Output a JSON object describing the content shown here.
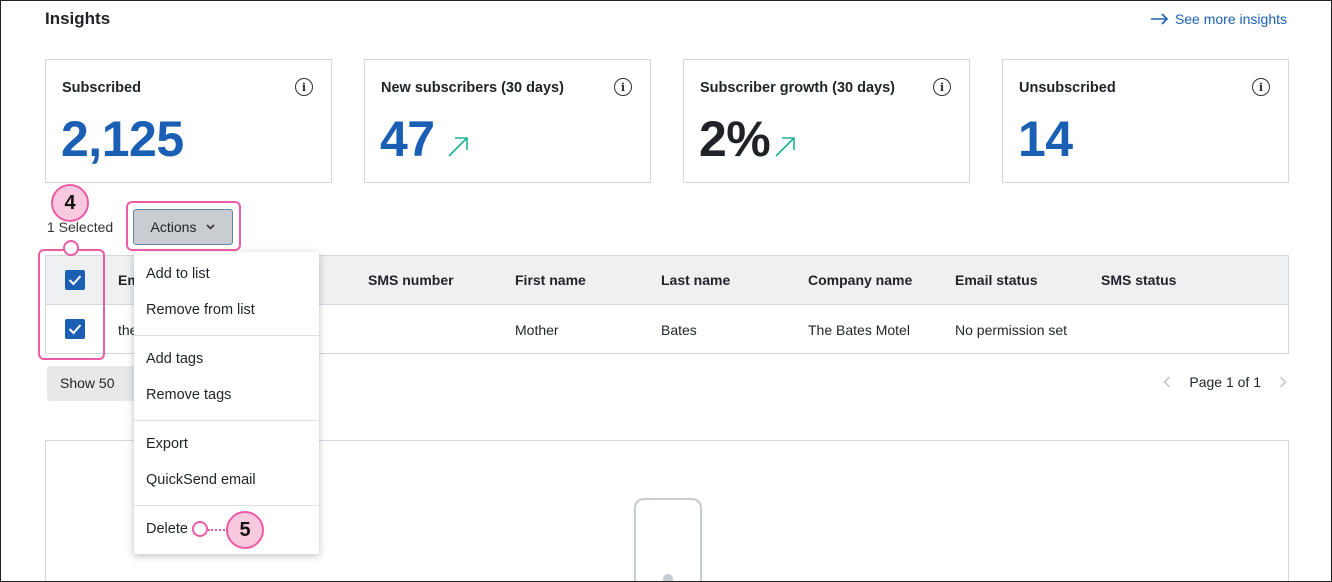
{
  "header": {
    "title": "Insights",
    "see_more": "See more insights"
  },
  "cards": [
    {
      "label": "Subscribed",
      "value": "2,125"
    },
    {
      "label": "New subscribers (30 days)",
      "value": "47",
      "trend": "up"
    },
    {
      "label": "Subscriber growth (30 days)",
      "value": "2%",
      "trend": "up"
    },
    {
      "label": "Unsubscribed",
      "value": "14"
    }
  ],
  "toolbar": {
    "selected": "1 Selected",
    "actions": "Actions"
  },
  "table": {
    "columns": [
      "Em",
      "SMS number",
      "First name",
      "Last name",
      "Company name",
      "Email status",
      "SMS status"
    ],
    "row": {
      "email": "the",
      "sms_number": "",
      "first_name": "Mother",
      "last_name": "Bates",
      "company": "The Bates Motel",
      "email_status": "No permission set",
      "sms_status": ""
    }
  },
  "pagination": {
    "show": "Show 50",
    "page": "Page 1 of 1"
  },
  "menu": {
    "items": [
      "Add to list",
      "Remove from list",
      "Add tags",
      "Remove tags",
      "Export",
      "QuickSend email",
      "Delete"
    ]
  },
  "annotations": {
    "step_a": "4",
    "step_b": "5"
  },
  "colors": {
    "accent": "#1a5fb4",
    "highlight": "#ec5ba5",
    "trend": "#1bb39a"
  }
}
